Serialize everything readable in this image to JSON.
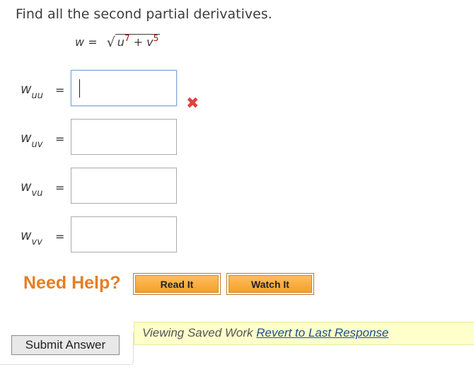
{
  "question": {
    "prompt": "Find all the second partial derivatives.",
    "equation": {
      "lhs": "w",
      "equals": "=",
      "radicand": {
        "term1_base": "u",
        "term1_exp": "7",
        "plus": "+",
        "term2_base": "v",
        "term2_exp": "5"
      }
    }
  },
  "rows": [
    {
      "label_base": "w",
      "label_sub": "uu",
      "eq": "=",
      "value": "",
      "status": "incorrect"
    },
    {
      "label_base": "w",
      "label_sub": "uv",
      "eq": "=",
      "value": ""
    },
    {
      "label_base": "w",
      "label_sub": "vu",
      "eq": "=",
      "value": ""
    },
    {
      "label_base": "w",
      "label_sub": "vv",
      "eq": "=",
      "value": ""
    }
  ],
  "help": {
    "label": "Need Help?",
    "read_it": "Read It",
    "watch_it": "Watch It"
  },
  "banner": {
    "text": "Viewing Saved Work ",
    "link": "Revert to Last Response"
  },
  "submit_label": "Submit Answer",
  "colors": {
    "incorrect_mark": "#e04040",
    "need_help": "#e67e22",
    "help_button": "#f4a02c",
    "banner_bg": "#ffffcc",
    "exponent": "#c00000"
  },
  "icons": {
    "incorrect": "x-mark-icon"
  }
}
